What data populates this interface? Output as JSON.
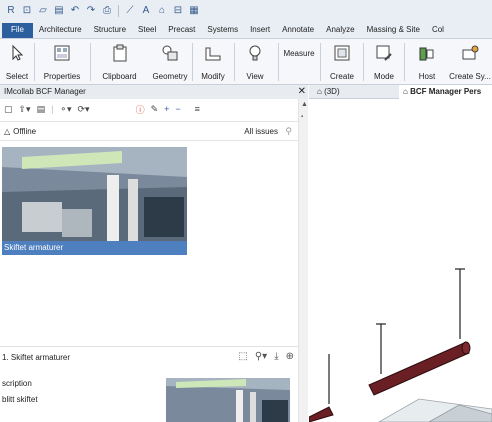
{
  "ribbon_tabs": [
    "File",
    "Architecture",
    "Structure",
    "Steel",
    "Precast",
    "Systems",
    "Insert",
    "Annotate",
    "Analyze",
    "Massing & Site",
    "Col"
  ],
  "ribbon_buttons": {
    "select": "Select",
    "properties": "Properties",
    "clipboard": "Clipboard",
    "geometry": "Geometry",
    "modify": "Modify",
    "view": "View",
    "measure": "Measure",
    "create": "Create",
    "mode": "Mode",
    "host": "Host",
    "create_sy": "Create Sy..."
  },
  "panel": {
    "title": "IMcollab BCF Manager",
    "status": "Offline",
    "filter_label": "All issues",
    "issue_thumb_caption": "Skiftet armaturer",
    "detail_title": "1. Skiftet armaturer",
    "description_label": "scription",
    "description_value": "blitt skiftet"
  },
  "view_tabs": [
    {
      "label": "(3D)"
    },
    {
      "label": "BCF Manager Pers"
    }
  ],
  "colors": {
    "file_tab": "#2d5f9e",
    "selection": "#4e7fbf",
    "fixture": "#6a1f24"
  },
  "icons": [
    "revit-logo-icon",
    "open-icon",
    "save-icon",
    "undo-icon",
    "redo-icon",
    "print-icon",
    "measure-icon",
    "text-icon",
    "3d-view-icon",
    "close-icon",
    "add-icon",
    "remove-icon",
    "menu-icon",
    "offline-icon",
    "filter-icon",
    "zoom-icon"
  ]
}
